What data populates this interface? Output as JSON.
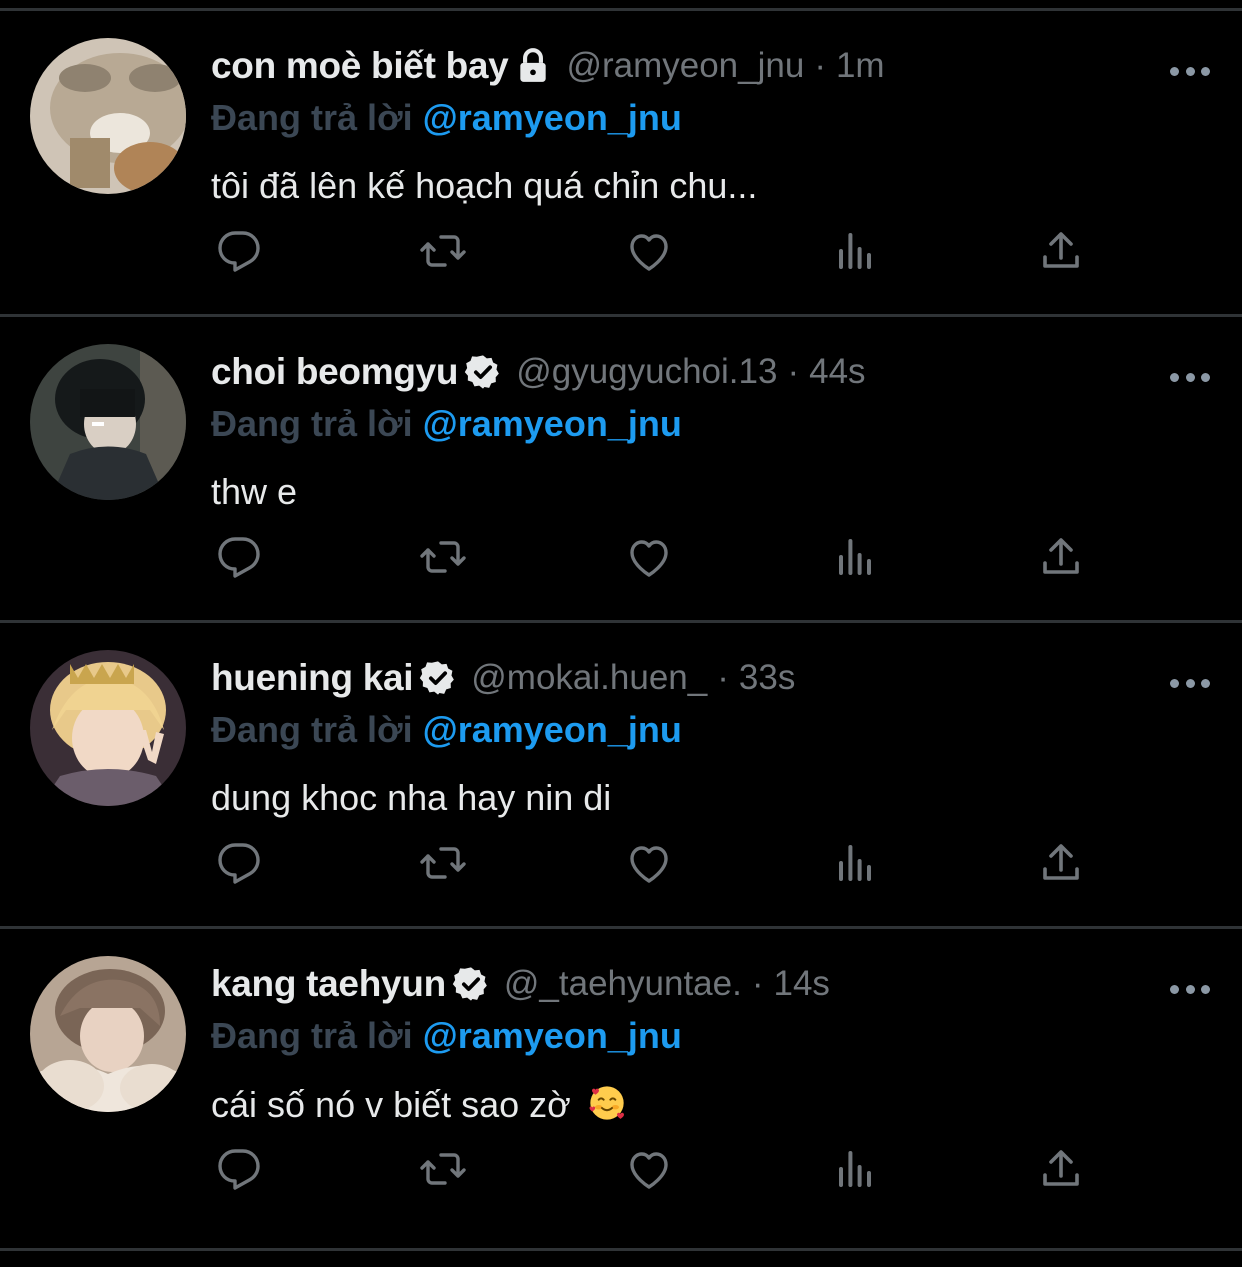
{
  "tweets": [
    {
      "display_name": "con moè biết bay",
      "badge": "lock-icon",
      "handle": "@ramyeon_jnu",
      "separator": "·",
      "time": "1m",
      "reply_prefix": "Đang trả lời",
      "reply_handle": "@ramyeon_jnu",
      "text": "tôi đã lên kế hoạch quá chỉn chu..."
    },
    {
      "display_name": "choi beomgyu",
      "badge": "verified-icon",
      "handle": "@gyugyuchoi.13",
      "separator": "·",
      "time": "44s",
      "reply_prefix": "Đang trả lời",
      "reply_handle": "@ramyeon_jnu",
      "text": "thw e"
    },
    {
      "display_name": "huening kai",
      "badge": "verified-icon",
      "handle": "@mokai.huen_",
      "separator": "·",
      "time": "33s",
      "reply_prefix": "Đang trả lời",
      "reply_handle": "@ramyeon_jnu",
      "text": "dung khoc nha hay nin di"
    },
    {
      "display_name": "kang taehyun",
      "badge": "verified-icon",
      "handle": "@_taehyuntae.",
      "separator": "·",
      "time": "14s",
      "reply_prefix": "Đang trả lời",
      "reply_handle": "@ramyeon_jnu",
      "text": "cái số nó v biết sao zờ",
      "emoji": "smiling-face-with-hearts-emoji"
    }
  ],
  "actions": [
    "reply-icon",
    "retweet-icon",
    "like-icon",
    "views-icon",
    "share-icon"
  ],
  "colors": {
    "background": "#000000",
    "name": "#e7e9ea",
    "muted": "#71767b",
    "reply_prefix": "#3b4754",
    "accent": "#1d9bf0",
    "icon": "#71767b",
    "divider": "#2f3336"
  }
}
